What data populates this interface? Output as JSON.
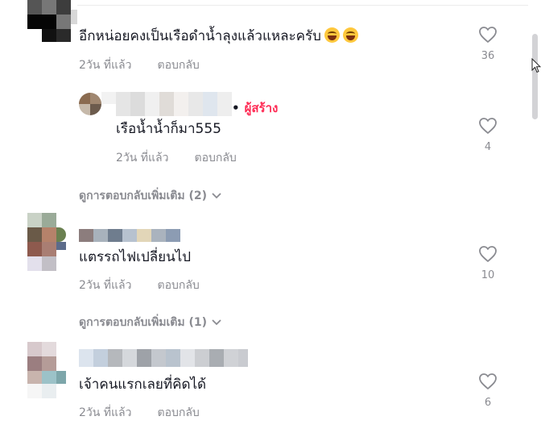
{
  "comments": [
    {
      "text": "อีกหน่อยคงเป็นเรือดำน้ำลุงแล้วแหละครับ",
      "emoji_icon": "laughing-tears-emoji",
      "time": "2วัน ที่แล้ว",
      "reply": "ตอบกลับ",
      "likes": "36"
    },
    {
      "creator_label": "ผู้สร้าง",
      "text": "เรือน้ำน้ำก็มา555",
      "time": "2วัน ที่แล้ว",
      "reply": "ตอบกลับ",
      "likes": "4"
    },
    {
      "more_replies": "ดูการตอบกลับเพิ่มเติม (2)"
    },
    {
      "text": "แตรรถไฟเปลี่ยนไป",
      "time": "2วัน ที่แล้ว",
      "reply": "ตอบกลับ",
      "likes": "10"
    },
    {
      "more_replies": "ดูการตอบกลับเพิ่มเติม (1)"
    },
    {
      "text": "เจ้าคนแรกเลยที่คิดได้",
      "time": "2วัน ที่แล้ว",
      "reply": "ตอบกลับ",
      "likes": "6"
    }
  ],
  "colors": {
    "creator": "#fe2c55",
    "meta": "#8a8b91",
    "text": "#161823"
  },
  "icons": [
    "heart-outline-icon",
    "chevron-down-icon",
    "mouse-pointer-icon"
  ]
}
